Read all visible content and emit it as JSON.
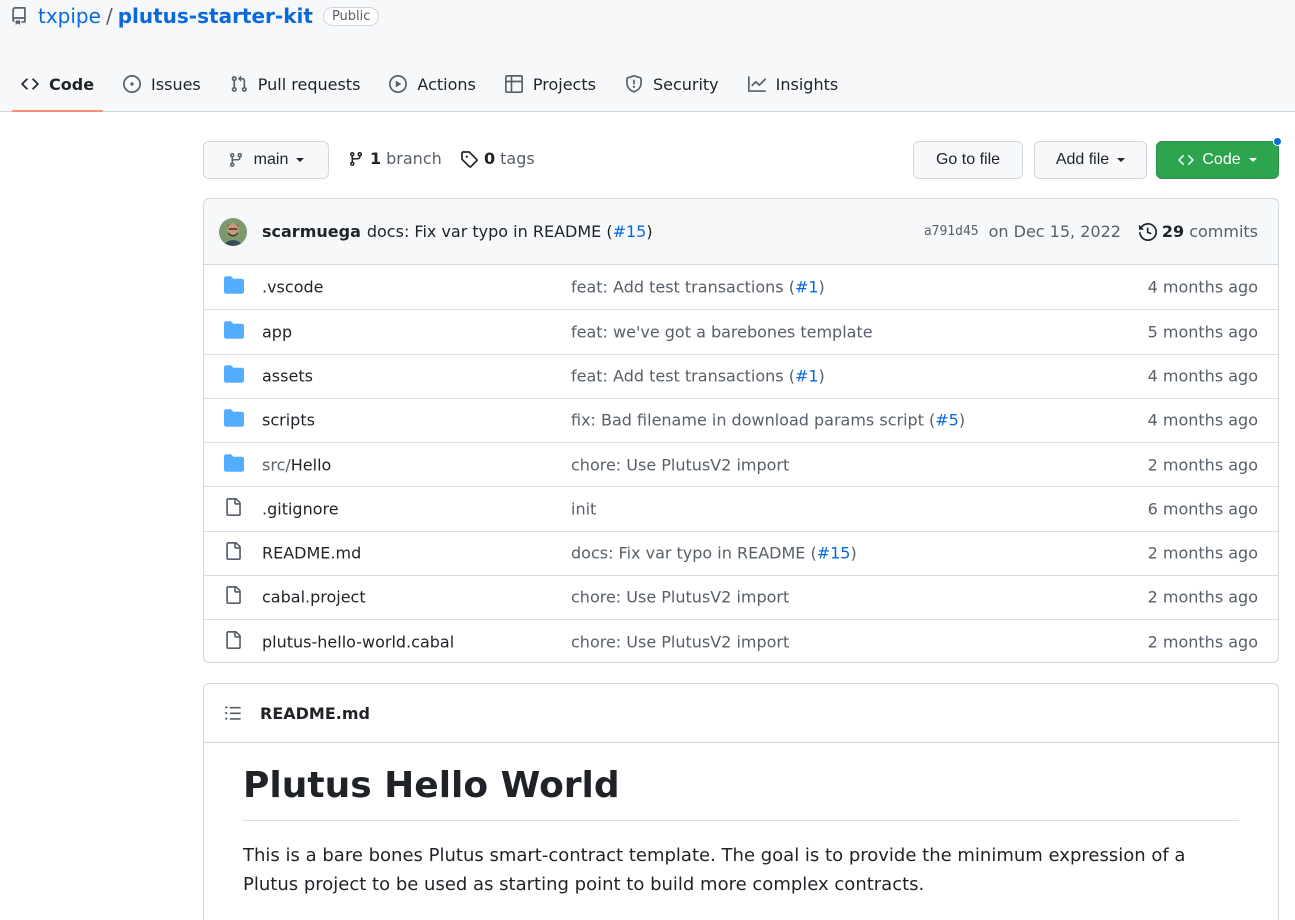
{
  "repo": {
    "owner": "txpipe",
    "separator": "/",
    "name": "plutus-starter-kit",
    "visibility": "Public"
  },
  "tabs": [
    {
      "label": "Code",
      "icon": "code-icon",
      "selected": true
    },
    {
      "label": "Issues",
      "icon": "issue-opened-icon"
    },
    {
      "label": "Pull requests",
      "icon": "git-pull-request-icon"
    },
    {
      "label": "Actions",
      "icon": "play-icon"
    },
    {
      "label": "Projects",
      "icon": "table-icon"
    },
    {
      "label": "Security",
      "icon": "shield-icon"
    },
    {
      "label": "Insights",
      "icon": "graph-icon"
    }
  ],
  "toolbar": {
    "branch": "main",
    "branch_count": "1",
    "branch_label": "branch",
    "tag_count": "0",
    "tag_label": "tags",
    "go_to_file": "Go to file",
    "add_file": "Add file",
    "code": "Code"
  },
  "latest_commit": {
    "author": "scarmuega",
    "message": "docs: Fix var typo in README (",
    "link": "#15",
    "message_end": ")",
    "sha": "a791d45",
    "date": "on Dec 15, 2022",
    "count": "29",
    "count_label": "commits"
  },
  "files": [
    {
      "type": "dir",
      "prefix": "",
      "name": ".vscode",
      "msg": "feat: Add test transactions (",
      "link": "#1",
      "msg_end": ")",
      "age": "4 months ago"
    },
    {
      "type": "dir",
      "prefix": "",
      "name": "app",
      "msg": "feat: we've got a barebones template",
      "link": "",
      "msg_end": "",
      "age": "5 months ago"
    },
    {
      "type": "dir",
      "prefix": "",
      "name": "assets",
      "msg": "feat: Add test transactions (",
      "link": "#1",
      "msg_end": ")",
      "age": "4 months ago"
    },
    {
      "type": "dir",
      "prefix": "",
      "name": "scripts",
      "msg": "fix: Bad filename in download params script (",
      "link": "#5",
      "msg_end": ")",
      "age": "4 months ago"
    },
    {
      "type": "dir",
      "prefix": "src/",
      "name": "Hello",
      "msg": "chore: Use PlutusV2 import",
      "link": "",
      "msg_end": "",
      "age": "2 months ago"
    },
    {
      "type": "file",
      "prefix": "",
      "name": ".gitignore",
      "msg": "init",
      "link": "",
      "msg_end": "",
      "age": "6 months ago"
    },
    {
      "type": "file",
      "prefix": "",
      "name": "README.md",
      "msg": "docs: Fix var typo in README (",
      "link": "#15",
      "msg_end": ")",
      "age": "2 months ago"
    },
    {
      "type": "file",
      "prefix": "",
      "name": "cabal.project",
      "msg": "chore: Use PlutusV2 import",
      "link": "",
      "msg_end": "",
      "age": "2 months ago"
    },
    {
      "type": "file",
      "prefix": "",
      "name": "plutus-hello-world.cabal",
      "msg": "chore: Use PlutusV2 import",
      "link": "",
      "msg_end": "",
      "age": "2 months ago"
    }
  ],
  "readme": {
    "filename": "README.md",
    "heading": "Plutus Hello World",
    "paragraph": "This is a bare bones Plutus smart-contract template. The goal is to provide the minimum expression of a Plutus project to be used as starting point to build more complex contracts."
  },
  "colors": {
    "accent": "#0969da",
    "primary_button": "#2da44e",
    "folder": "#54aeff",
    "tab_underline": "#fd8c73"
  }
}
